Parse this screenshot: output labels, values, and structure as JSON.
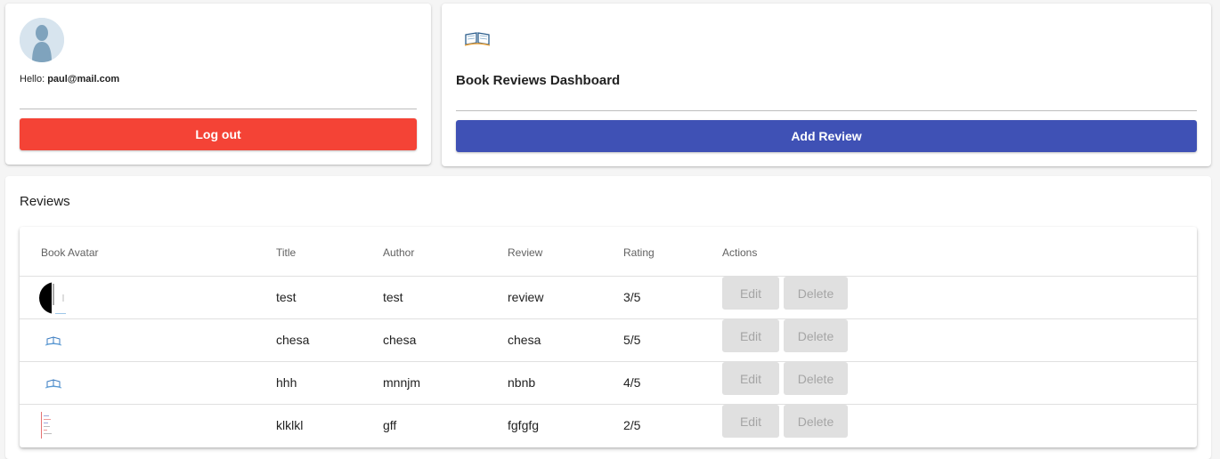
{
  "user": {
    "hello_prefix": "Hello:",
    "email": "paul@mail.com",
    "logout_label": "Log out",
    "logout_color": "#f44336"
  },
  "dashboard": {
    "title": "Book Reviews Dashboard",
    "add_label": "Add Review",
    "add_color": "#3f51b5"
  },
  "reviews": {
    "title": "Reviews",
    "columns": [
      "Book Avatar",
      "Title",
      "Author",
      "Review",
      "Rating",
      "Actions"
    ],
    "rows": [
      {
        "avatar": "black-white-photo-thumbnail",
        "title": "test",
        "author": "test",
        "review": "review",
        "rating": "3/5"
      },
      {
        "avatar": "open-book-icon",
        "title": "chesa",
        "author": "chesa",
        "review": "chesa",
        "rating": "5/5"
      },
      {
        "avatar": "open-book-icon",
        "title": "hhh",
        "author": "mnnjm",
        "review": "nbnb",
        "rating": "4/5"
      },
      {
        "avatar": "document-thumbnail",
        "title": "klklkl",
        "author": "gff",
        "review": "fgfgfg",
        "rating": "2/5"
      }
    ],
    "edit_label": "Edit",
    "delete_label": "Delete"
  }
}
